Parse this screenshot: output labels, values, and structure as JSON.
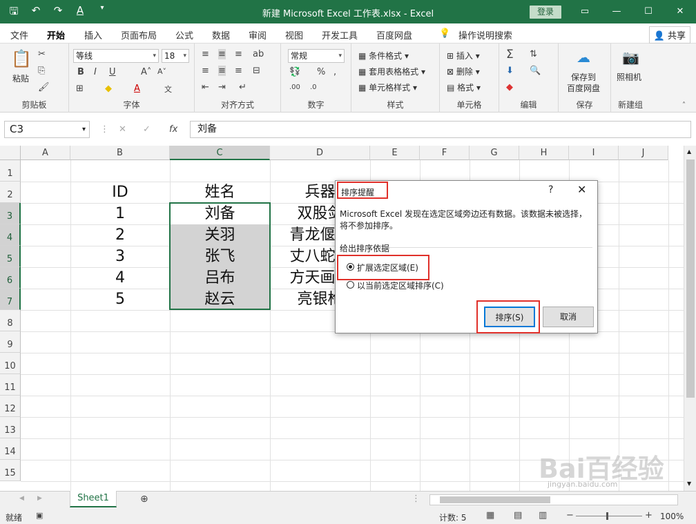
{
  "titlebar": {
    "title": "新建 Microsoft Excel 工作表.xlsx  -  Excel",
    "login": "登录"
  },
  "tabs": [
    "文件",
    "开始",
    "插入",
    "页面布局",
    "公式",
    "数据",
    "审阅",
    "视图",
    "开发工具",
    "百度网盘"
  ],
  "tell_me": "操作说明搜索",
  "share": "共享",
  "ribbon": {
    "paste": "粘贴",
    "font_name": "等线",
    "font_size": "18",
    "number_format": "常规",
    "cond_format": "条件格式",
    "table_format": "套用表格格式",
    "cell_style": "单元格样式",
    "insert": "插入",
    "delete": "删除",
    "format": "格式",
    "save_to": "保存到",
    "baidu": "百度网盘",
    "camera": "照相机",
    "groups": {
      "clipboard": "剪贴板",
      "font": "字体",
      "align": "对齐方式",
      "number": "数字",
      "styles": "样式",
      "cells": "单元格",
      "edit": "编辑",
      "save": "保存",
      "new": "新建组"
    }
  },
  "formula_bar": {
    "namebox": "C3",
    "fx": "fx",
    "content": "刘备"
  },
  "columns": [
    "A",
    "B",
    "C",
    "D",
    "E",
    "F",
    "G",
    "H",
    "I",
    "J"
  ],
  "rows": [
    "1",
    "2",
    "3",
    "4",
    "5",
    "6",
    "7",
    "8",
    "9",
    "10",
    "11",
    "12",
    "13",
    "14",
    "15"
  ],
  "cells": {
    "B2": "ID",
    "C2": "姓名",
    "D2": "兵器",
    "B3": "1",
    "C3": "刘备",
    "D3": "双股剑",
    "B4": "2",
    "C4": "关羽",
    "D4": "青龙偃月",
    "B5": "3",
    "C5": "张飞",
    "D5": "丈八蛇矛",
    "B6": "4",
    "C6": "吕布",
    "D6": "方天画戟",
    "B7": "5",
    "C7": "赵云",
    "D7": "亮银枪"
  },
  "dialog": {
    "title": "排序提醒",
    "help": "?",
    "close": "✕",
    "message": "Microsoft Excel 发现在选定区域旁边还有数据。该数据未被选择，将不参加排序。",
    "section": "给出排序依据",
    "option1": "扩展选定区域(E)",
    "option2": "以当前选定区域排序(C)",
    "sort_button": "排序(S)",
    "cancel_button": "取消"
  },
  "sheet": {
    "tab": "Sheet1"
  },
  "status": {
    "ready": "就绪",
    "count": "计数: 5",
    "zoom": "100%"
  },
  "watermark": {
    "brand": "Bai百经验",
    "url": "jingyan.baidu.com"
  }
}
